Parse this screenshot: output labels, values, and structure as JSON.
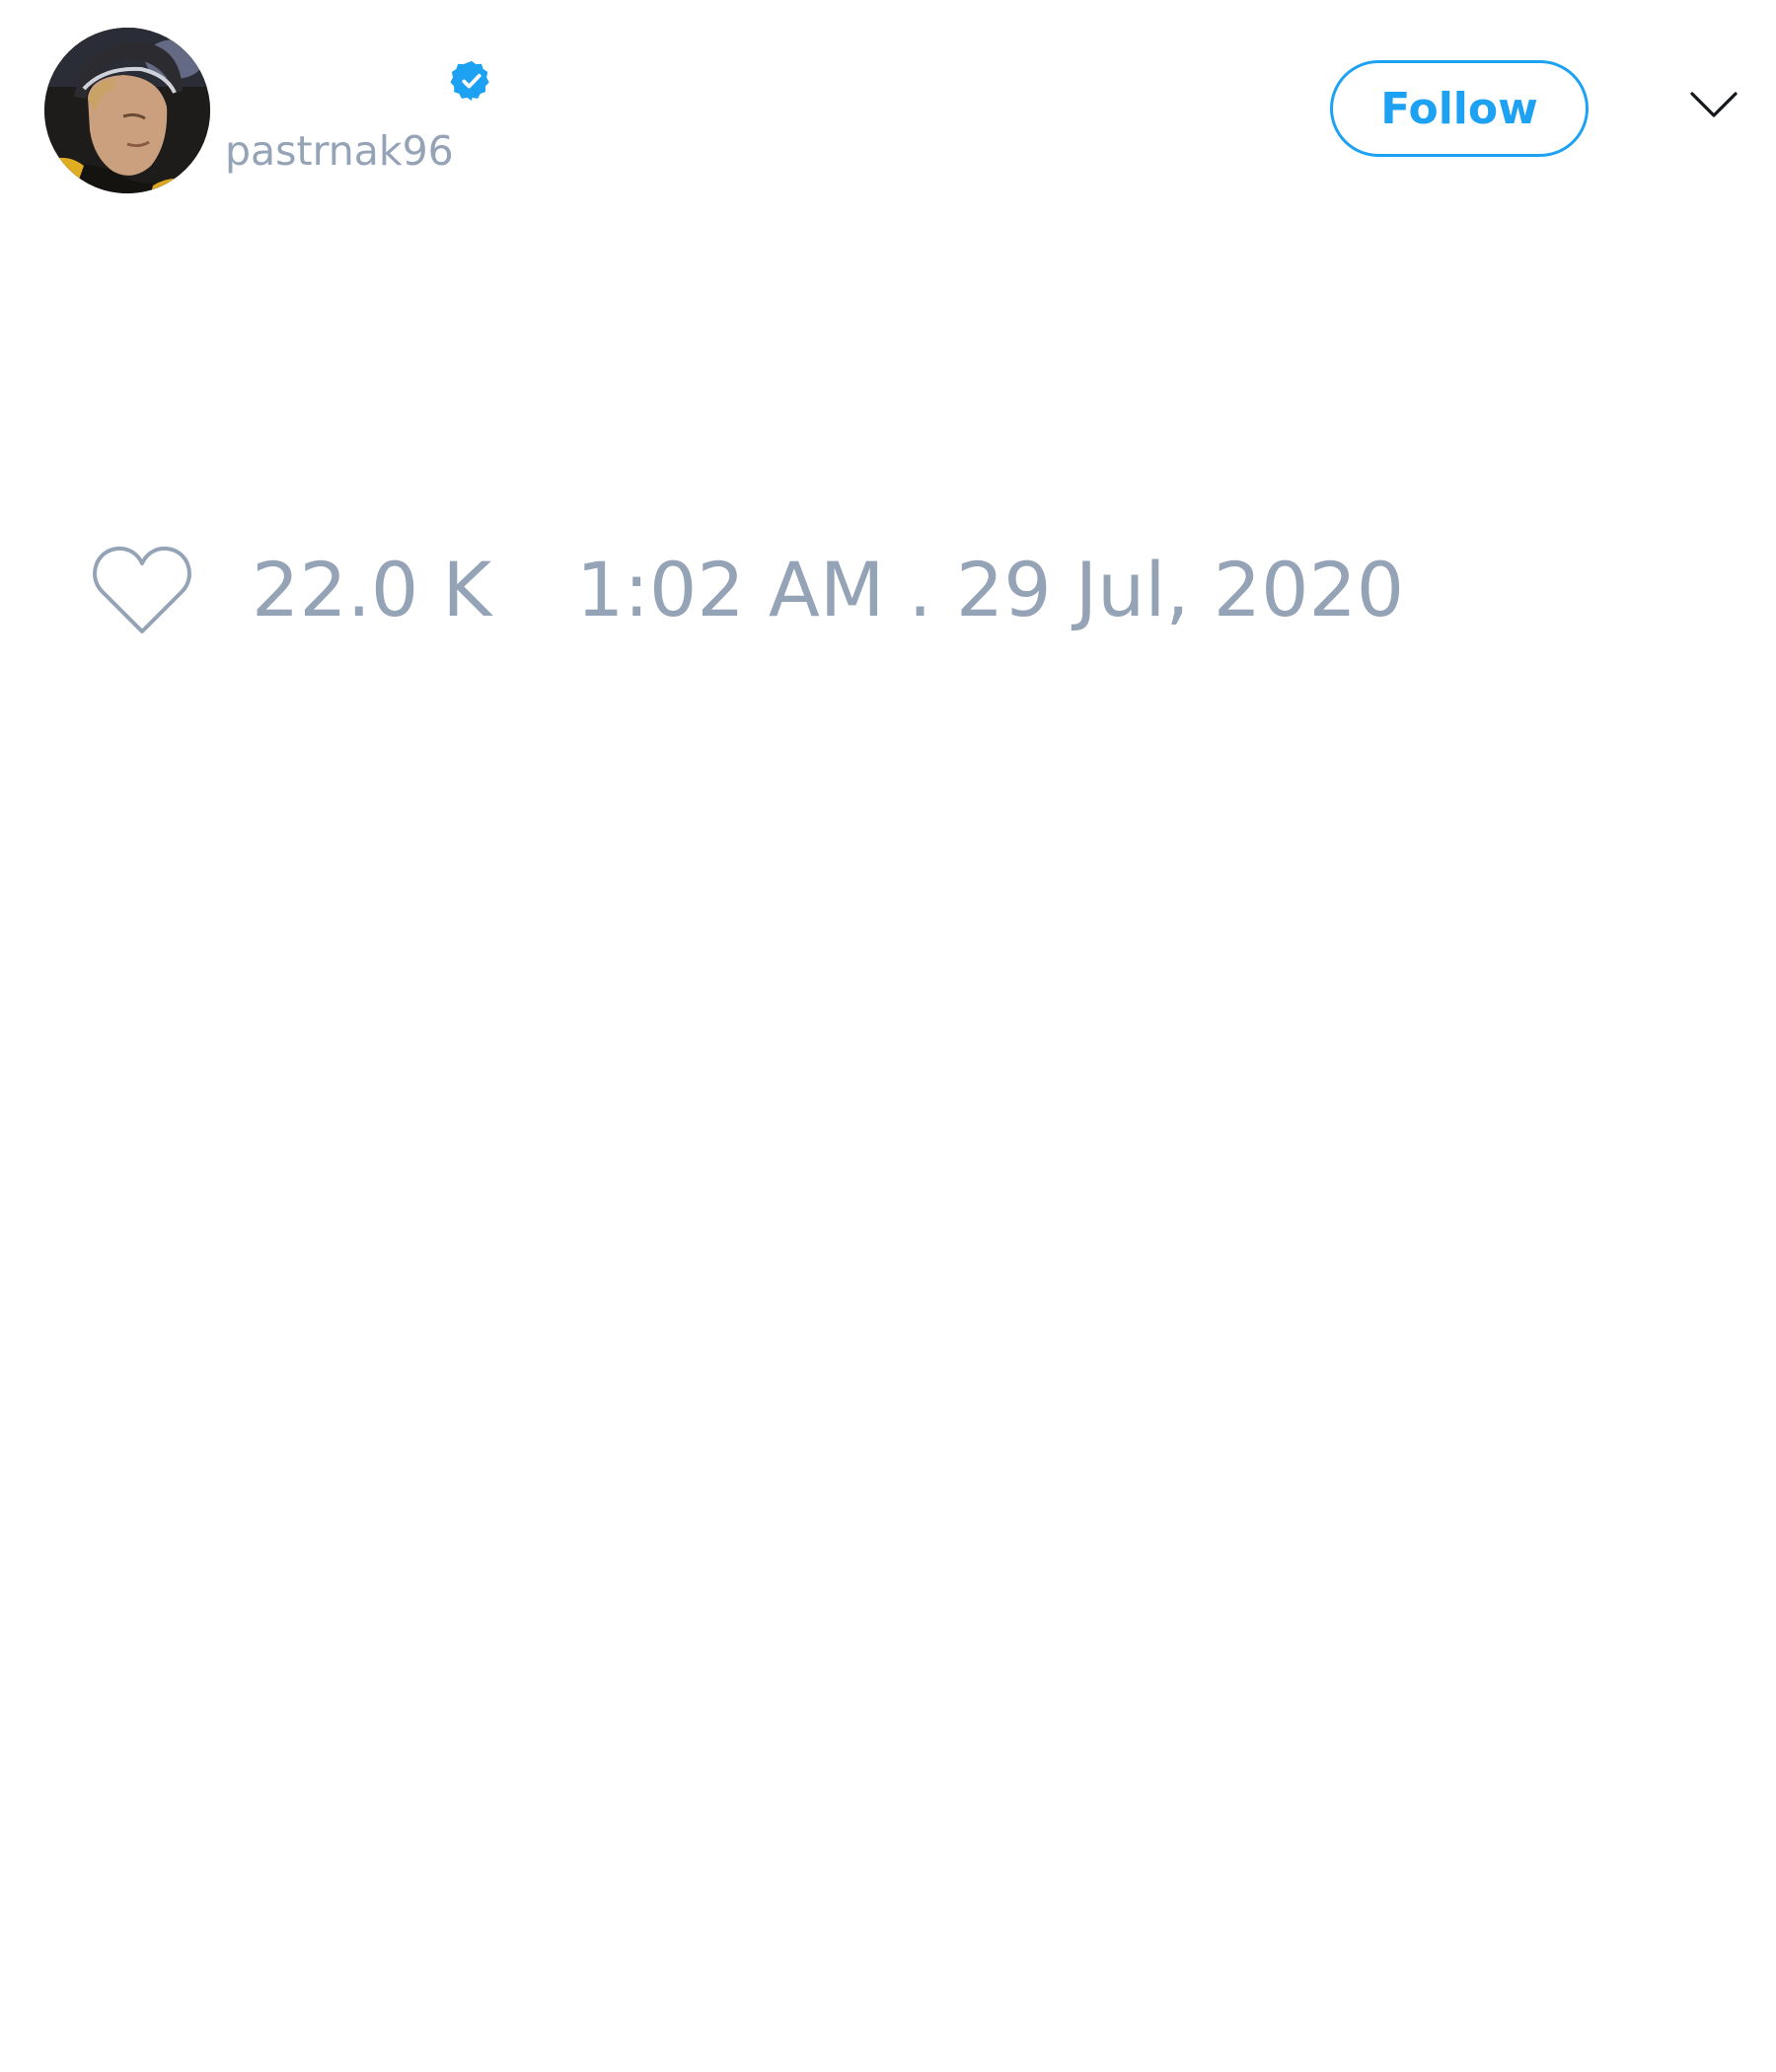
{
  "tweet": {
    "author": {
      "display_name": "",
      "username": "pastrnak96",
      "verified": true,
      "avatar_icon": "avatar-photo"
    },
    "follow_label": "Follow",
    "menu_icon": "chevron-down-icon",
    "like_icon": "heart-outline-icon",
    "like_count": "22.0 K",
    "timestamp": "1:02 AM . 29 Jul, 2020"
  },
  "colors": {
    "accent": "#1da1f2",
    "muted_text": "#95a3b6",
    "background": "#ffffff"
  }
}
